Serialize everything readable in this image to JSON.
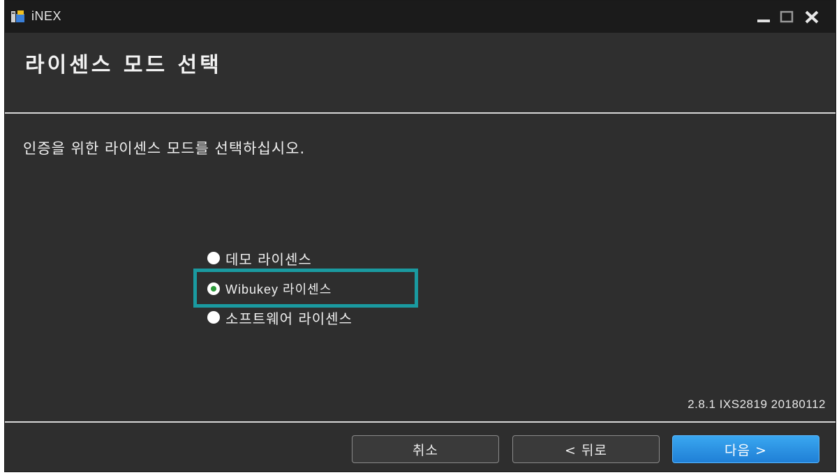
{
  "window": {
    "title": "iNEX",
    "icon": "app-installer-icon",
    "controls": [
      "minimize-icon",
      "maximize-icon",
      "close-icon"
    ]
  },
  "header": {
    "title": "라이센스 모드 선택"
  },
  "content": {
    "instruction": "인증을 위한 라이센스 모드를 선택하십시오.",
    "options": [
      {
        "label": "데모 라이센스",
        "checked": false
      },
      {
        "label": "Wibukey 라이센스",
        "checked": true
      },
      {
        "label": "소프트웨어 라이센스",
        "checked": false
      }
    ],
    "highlight_color": "#1a9aa0",
    "version": "2.8.1 IXS2819 20180112"
  },
  "footer": {
    "cancel_label": "취소",
    "back_label": "< 뒤로",
    "next_label": "다음 >",
    "accent_color": "#2b8fe6"
  }
}
